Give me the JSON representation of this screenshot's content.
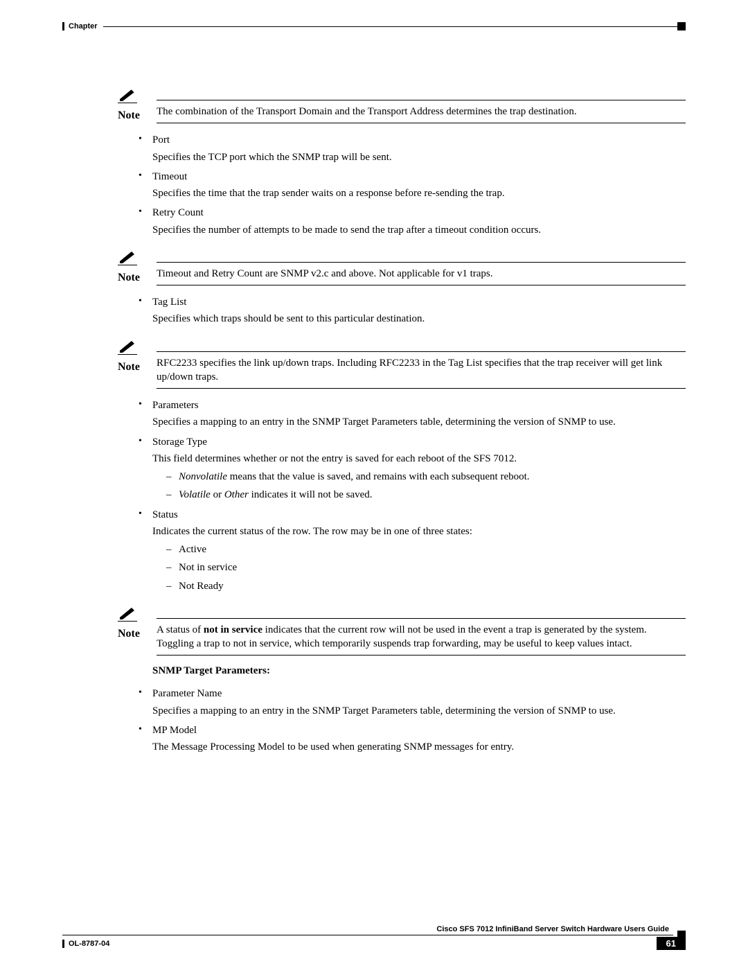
{
  "header": {
    "chapter": "Chapter"
  },
  "note1": {
    "label": "Note",
    "text": "The combination of the Transport Domain and the Transport Address determines the trap destination."
  },
  "list1": {
    "items": [
      {
        "title": "Port",
        "desc": "Specifies the TCP port which the SNMP trap will be sent."
      },
      {
        "title": "Timeout",
        "desc": "Specifies the time that the trap sender waits on a response before re-sending the trap."
      },
      {
        "title": "Retry Count",
        "desc": "Specifies the number of attempts to be made to send the trap after a timeout condition occurs."
      }
    ]
  },
  "note2": {
    "label": "Note",
    "text": "Timeout and Retry Count are SNMP v2.c and above. Not applicable for v1 traps."
  },
  "list2": {
    "items": [
      {
        "title": "Tag List",
        "desc": "Specifies which traps should be sent to this particular destination."
      }
    ]
  },
  "note3": {
    "label": "Note",
    "text": "RFC2233 specifies the link up/down traps. Including RFC2233 in the Tag List specifies that the trap receiver will get link up/down traps."
  },
  "list3": {
    "parameters": {
      "title": "Parameters",
      "desc": "Specifies a mapping to an entry in the SNMP Target Parameters table, determining the version of SNMP to use."
    },
    "storage": {
      "title": "Storage Type",
      "desc": "This field determines whether or not the entry is saved for each reboot of the SFS 7012.",
      "sub1_em1": "Nonvolatile",
      "sub1_rest": " means that the value is saved, and remains with each subsequent reboot.",
      "sub2_em1": "Volatile",
      "sub2_mid": " or ",
      "sub2_em2": "Other",
      "sub2_rest": " indicates it will not be saved."
    },
    "status": {
      "title": "Status",
      "desc": "Indicates the current status of the row. The row may be in one of three states:",
      "sub": [
        "Active",
        "Not in service",
        "Not Ready"
      ]
    }
  },
  "note4": {
    "label": "Note",
    "pre": "A status of ",
    "bold": "not in service",
    "post": " indicates that the current row will not be used in the event a trap is generated by the system. Toggling a trap to not in service, which temporarily suspends trap forwarding, may be useful to keep values intact."
  },
  "sectionHead": "SNMP Target Parameters:",
  "list4": {
    "items": [
      {
        "title": "Parameter Name",
        "desc": "Specifies a mapping to an entry in the SNMP Target Parameters table, determining the version of SNMP to use."
      },
      {
        "title": "MP Model",
        "desc": "The Message Processing Model to be used when generating SNMP messages for entry."
      }
    ]
  },
  "footer": {
    "guide": "Cisco SFS 7012 InfiniBand Server Switch Hardware Users Guide",
    "docnum": "OL-8787-04",
    "page": "61"
  }
}
